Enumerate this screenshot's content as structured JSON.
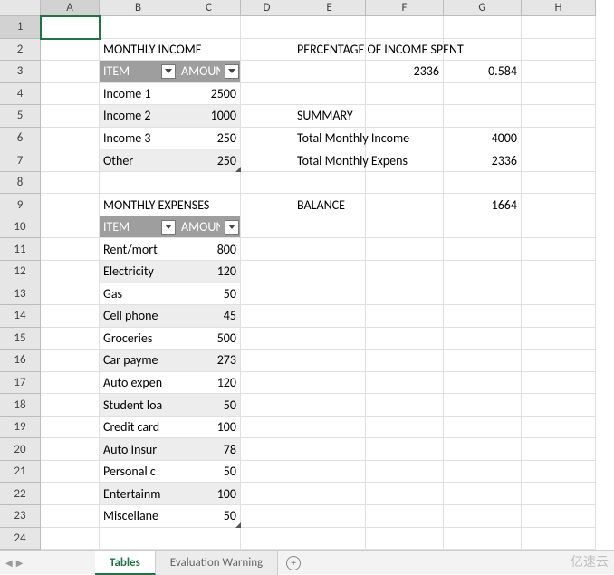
{
  "columns": [
    "A",
    "B",
    "C",
    "D",
    "E",
    "F",
    "G",
    "H"
  ],
  "column_widths": [
    "wA",
    "wB",
    "wC",
    "wD",
    "wE",
    "wF",
    "wG",
    "wH"
  ],
  "rowcount": 24,
  "selected_cell": {
    "row": 1,
    "col": "A"
  },
  "titles": {
    "income": "MONTHLY INCOME",
    "expenses": "MONTHLY EXPENSES",
    "percentage": "PERCENTAGE OF INCOME SPENT",
    "summary": "SUMMARY",
    "balance": "BALANCE"
  },
  "headers": {
    "item": "ITEM",
    "amount": "AMOUNT"
  },
  "income": [
    {
      "item": "Income 1",
      "amount": 2500
    },
    {
      "item": "Income 2",
      "amount": 1000
    },
    {
      "item": "Income 3",
      "amount": 250
    },
    {
      "item": "Other",
      "amount": 250
    }
  ],
  "expenses": [
    {
      "item": "Rent/mortgage",
      "amount": 800,
      "disp": "Rent/mort"
    },
    {
      "item": "Electricity",
      "amount": 120,
      "disp": "Electricity"
    },
    {
      "item": "Gas",
      "amount": 50,
      "disp": "Gas"
    },
    {
      "item": "Cell phone",
      "amount": 45,
      "disp": "Cell phone"
    },
    {
      "item": "Groceries",
      "amount": 500,
      "disp": "Groceries"
    },
    {
      "item": "Car payment",
      "amount": 273,
      "disp": "Car payme"
    },
    {
      "item": "Auto expenses",
      "amount": 120,
      "disp": "Auto expen"
    },
    {
      "item": "Student loan",
      "amount": 50,
      "disp": "Student loa"
    },
    {
      "item": "Credit card",
      "amount": 100,
      "disp": "Credit card"
    },
    {
      "item": "Auto Insurance",
      "amount": 78,
      "disp": "Auto Insur"
    },
    {
      "item": "Personal care",
      "amount": 50,
      "disp": "Personal c"
    },
    {
      "item": "Entertainment",
      "amount": 100,
      "disp": "Entertainm"
    },
    {
      "item": "Miscellaneous",
      "amount": 50,
      "disp": "Miscellane"
    }
  ],
  "percentage": {
    "total": 2336,
    "value": 0.584
  },
  "summary_rows": [
    {
      "label": "Total Monthly Income",
      "disp": "Total Monthly Income",
      "value": 4000
    },
    {
      "label": "Total Monthly Expenses",
      "disp": "Total Monthly Expens",
      "value": 2336
    }
  ],
  "balance_value": 1664,
  "sheets": {
    "active": "Tables",
    "others": [
      "Evaluation Warning"
    ]
  },
  "watermark": "亿速云"
}
